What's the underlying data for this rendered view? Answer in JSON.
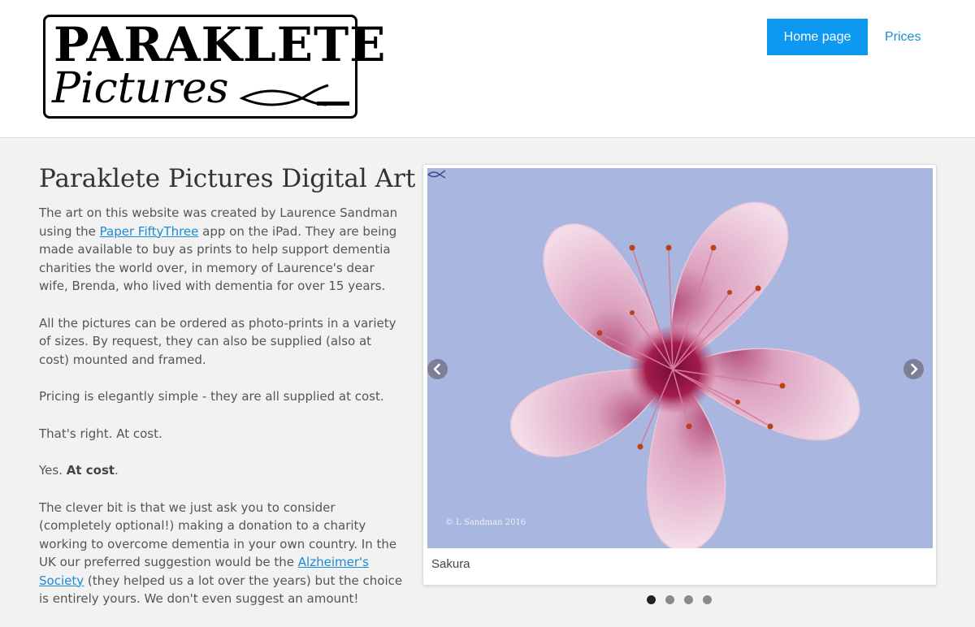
{
  "logo": {
    "title": "PARAKLETE",
    "subtitle": "Pictures"
  },
  "nav": {
    "home": "Home page",
    "prices": "Prices"
  },
  "main": {
    "heading": "Paraklete Pictures Digital Art",
    "p1_a": "The art on this website was created by Laurence Sandman using the ",
    "p1_link": "Paper FiftyThree",
    "p1_b": " app on the iPad. They are being made available to buy as prints to help support dementia charities the world over, in memory of Laurence's dear wife, Brenda, who lived with dementia for over 15 years.",
    "p2": "All the pictures can be ordered as photo-prints in a variety of sizes. By request, they can also be supplied (also at cost) mounted and framed.",
    "p3": "Pricing is elegantly simple - they are all supplied at cost.",
    "p4": "That's right. At cost.",
    "p5_a": "Yes. ",
    "p5_bold": "At cost",
    "p5_b": ".",
    "p6_a": "The clever bit is that we just ask you to consider (completely optional!) making a donation to a charity working to overcome dementia in your own country. In the UK our preferred suggestion would be the ",
    "p6_link": "Alzheimer's Society",
    "p6_b": " (they helped us a lot over the years) but the choice is entirely yours. We don't even suggest an amount!"
  },
  "carousel": {
    "caption": "Sakura",
    "copyright": "© L Sandman 2016",
    "slide_count": 4,
    "active_index": 0,
    "image_subject": "pink cherry blossom on lavender background"
  },
  "colors": {
    "nav_active_bg": "#0d99f2",
    "link": "#1a8bd6",
    "page_bg": "#f2f2f2",
    "slide_bg": "#a9b6e0"
  }
}
